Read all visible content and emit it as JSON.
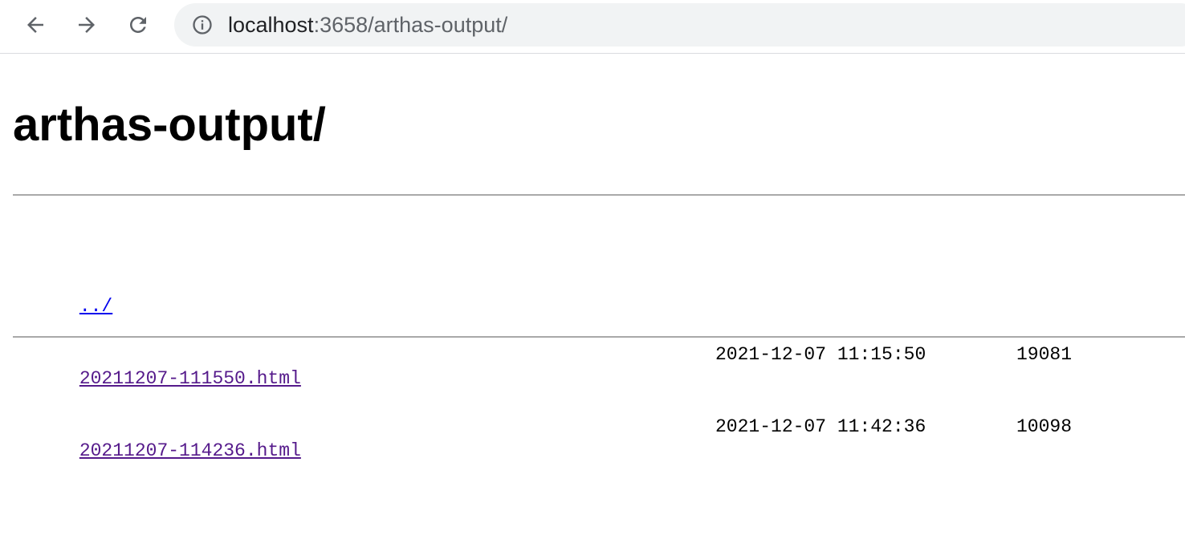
{
  "browser": {
    "url_host": "localhost",
    "url_path": ":3658/arthas-output/",
    "icons": {
      "back": "arrow-back-icon",
      "forward": "arrow-forward-icon",
      "reload": "reload-icon",
      "info": "info-icon"
    }
  },
  "page": {
    "title": "arthas-output/",
    "parent_link": "../",
    "files": [
      {
        "name": "20211207-111550.html",
        "date": "2021-12-07 11:15:50",
        "size": "19081"
      },
      {
        "name": "20211207-114236.html",
        "date": "2021-12-07 11:42:36",
        "size": "10098"
      }
    ],
    "colors": {
      "link": "#0000ee",
      "visited_link": "#551a8b",
      "rule": "#a9a9a9"
    }
  }
}
